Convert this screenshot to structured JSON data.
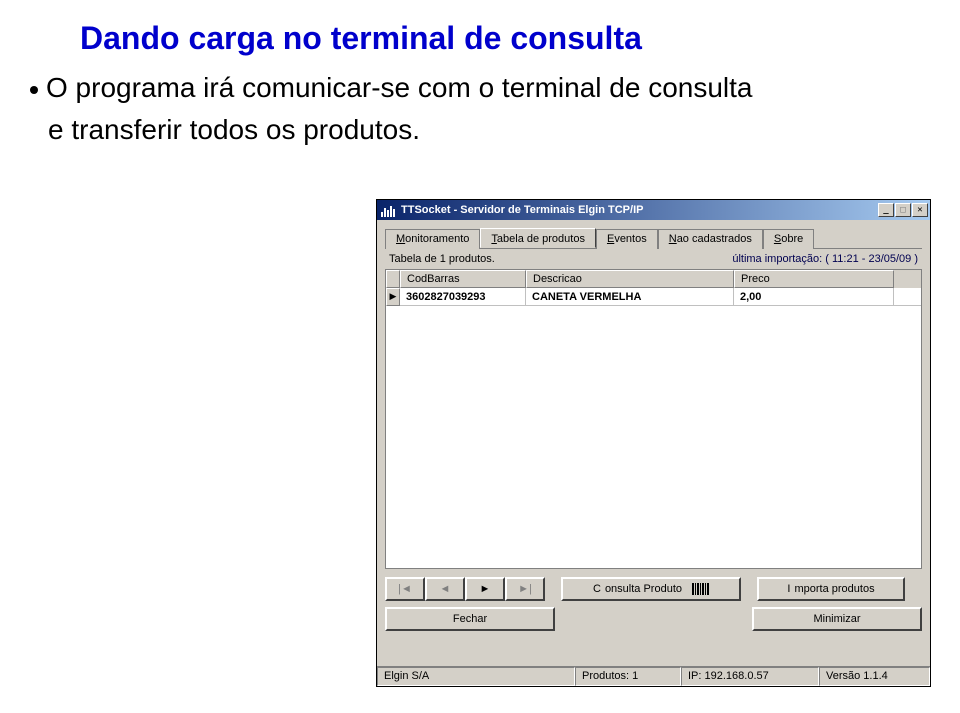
{
  "page": {
    "heading": "Dando carga no terminal de consulta",
    "bullet1": "O programa irá comunicar-se com o terminal de consulta",
    "bullet2": "e transferir todos os produtos."
  },
  "window": {
    "title": "TTSocket  - Servidor de Terminais Elgin TCP/IP",
    "tabs": {
      "monitoramento": "Monitoramento",
      "tabela": "Tabela de produtos",
      "eventos": "Eventos",
      "nao_cadastrados": "Nao cadastrados",
      "sobre": "Sobre"
    },
    "info": {
      "count": "Tabela de 1 produtos.",
      "import": "última importação: ( 11:21  -  23/05/09 )"
    },
    "columns": {
      "cod": "CodBarras",
      "desc": "Descricao",
      "preco": "Preco"
    },
    "row": {
      "cod": "3602827039293",
      "desc": "CANETA VERMELHA",
      "preco": "2,00"
    },
    "nav": {
      "first": "|◄",
      "prev": "◄",
      "next": "►",
      "last": "►|",
      "consulta": "Consulta Produto",
      "importa": "Importa produtos"
    },
    "buttons": {
      "fechar": "Fechar",
      "minimizar": "Minimizar"
    },
    "status": {
      "company": "Elgin S/A",
      "products": "Produtos: 1",
      "ip": "IP: 192.168.0.57",
      "version": "Versão 1.1.4"
    }
  }
}
